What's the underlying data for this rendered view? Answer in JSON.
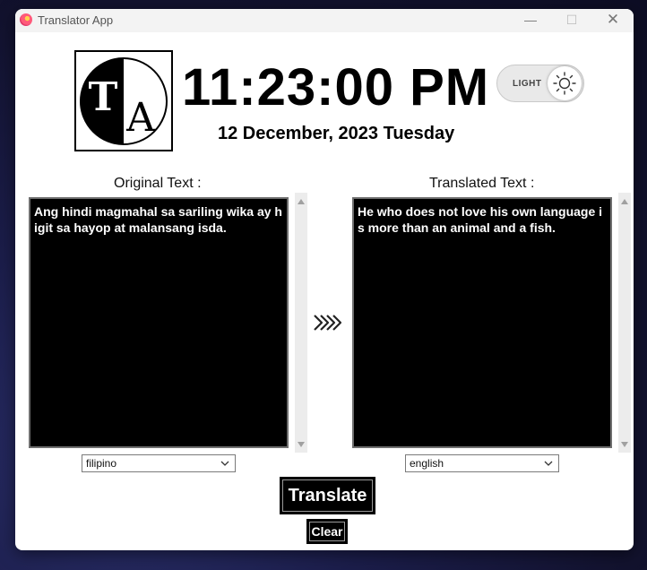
{
  "window": {
    "title": "Translator App",
    "controls": {
      "minimize": "—",
      "maximize": "☐",
      "close": "✕"
    }
  },
  "logo": {
    "left_letter": "T",
    "right_letter": "A",
    "icon": "ta-logo-icon"
  },
  "clock": {
    "time": "11:23:00 PM",
    "date": "12 December, 2023 Tuesday"
  },
  "theme_toggle": {
    "label": "LIGHT",
    "icon": "sun-icon"
  },
  "original": {
    "label": "Original Text :",
    "text": "Ang hindi magmahal sa sariling wika ay higit sa hayop at malansang isda.",
    "language": "filipino"
  },
  "translated": {
    "label": "Translated Text :",
    "text": "He who does not love his own language is more than an animal and a fish.",
    "language": "english"
  },
  "actions": {
    "translate": "Translate",
    "clear": "Clear"
  },
  "colors": {
    "text_area_bg": "#000000",
    "text_area_fg": "#ffffff",
    "button_bg": "#000000"
  }
}
